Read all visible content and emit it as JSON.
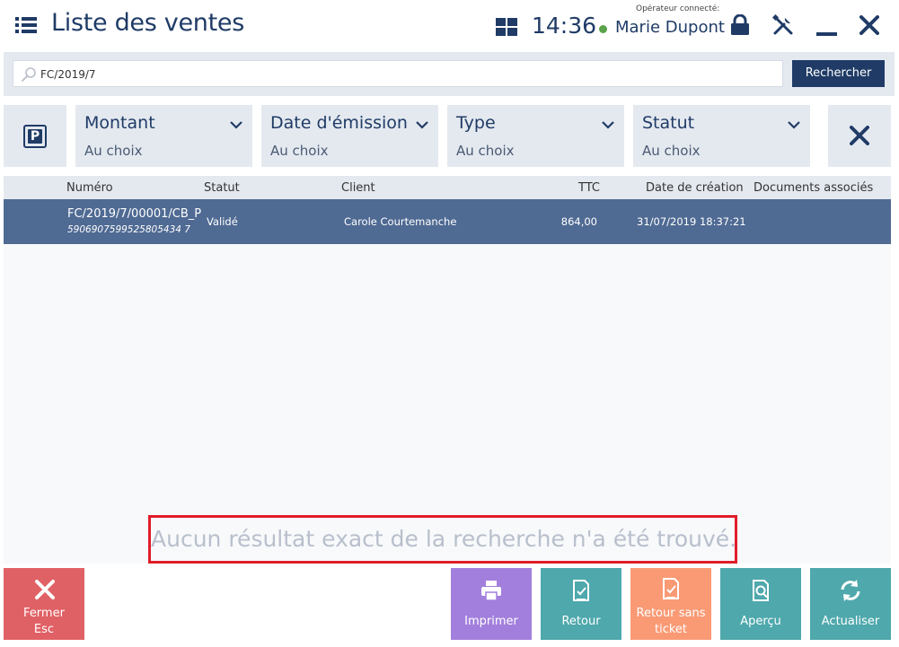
{
  "header": {
    "title": "Liste des ventes",
    "clock": "14:36",
    "operator_label": "Opérateur connecté:",
    "operator_name": "Marie Dupont"
  },
  "search": {
    "value": "FC/2019/7",
    "button_label": "Rechercher"
  },
  "filters": [
    {
      "title": "Montant",
      "value": "Au choix"
    },
    {
      "title": "Date d'émission",
      "value": "Au choix"
    },
    {
      "title": "Type",
      "value": "Au choix"
    },
    {
      "title": "Statut",
      "value": "Au choix"
    }
  ],
  "table": {
    "columns": [
      "Numéro",
      "Statut",
      "Client",
      "TTC",
      "Date de création",
      "Documents associés"
    ],
    "rows": [
      {
        "number": "FC/2019/7/00001/CB_P",
        "ean": "5906907599525805434 7",
        "status": "Validé",
        "client": "Carole Courtemanche",
        "ttc": "864,00",
        "created": "31/07/2019 18:37:21",
        "documents": ""
      }
    ]
  },
  "message": "Aucun résultat exact de la recherche n'a été trouvé.",
  "footer": {
    "close_label": "Fermer",
    "close_shortcut": "Esc",
    "print_label": "Imprimer",
    "return_label": "Retour",
    "return_no_ticket_label_1": "Retour sans",
    "return_no_ticket_label_2": "ticket",
    "preview_label": "Aperçu",
    "refresh_label": "Actualiser"
  },
  "colors": {
    "primary": "#1f3b66",
    "selected_row": "#4f6a93",
    "close": "#e06165",
    "print": "#a27fdc",
    "return": "#4ea8ac",
    "return_no_ticket": "#f99a75",
    "highlight_border": "#e11d2a"
  }
}
